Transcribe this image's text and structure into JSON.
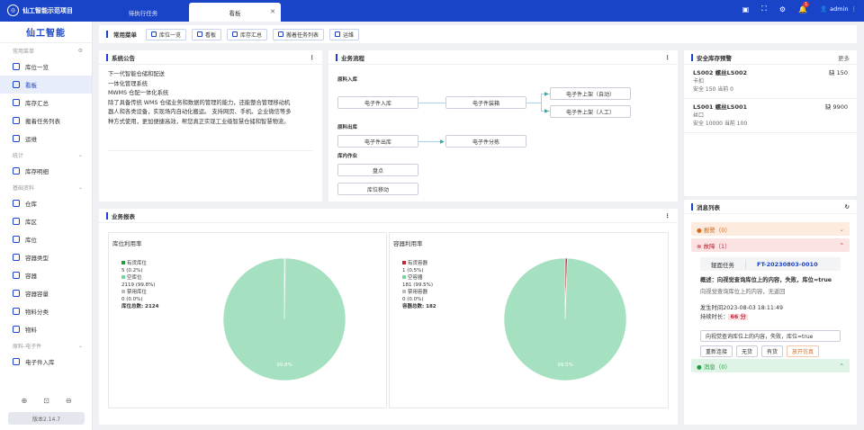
{
  "app": {
    "title": "仙工智能示范项目",
    "logo_text": "仙工智能",
    "user": "admin",
    "notify_count": "1"
  },
  "tabs": [
    {
      "label": "待执行任务"
    },
    {
      "label": "看板"
    }
  ],
  "sidebar": {
    "groups": {
      "common": "常用菜单",
      "stats": "统计",
      "basic": "基础资料",
      "raw": "原料-电子件"
    },
    "items": [
      "库位一览",
      "看板",
      "库存汇总",
      "搬着任务列表",
      "运维",
      "库存明细",
      "仓库",
      "库区",
      "库位",
      "容器类型",
      "容器",
      "容器容量",
      "物料分类",
      "物料",
      "电子件入库"
    ],
    "version": "版本2.14.7"
  },
  "quick": {
    "title": "常用菜单",
    "buttons": [
      "库位一览",
      "看板",
      "库存汇总",
      "搬着任务列表",
      "运维"
    ]
  },
  "announcement": {
    "title": "系统公告",
    "lines": [
      "下一代智能仓储和配送",
      "一体化管理系统",
      "MWMS 仓配一体化系统",
      "除了具备传统 WMS 仓储业务和数据的管理的能力，还能整合管理移动机",
      "器人和各类设备，实现场内自动化搬运。 支持网页、手机、企业微信等多",
      "种方式使用，更加便捷高效，帮您真正实现工业级智慧仓储和智慧物流。"
    ]
  },
  "flow": {
    "title": "业务流程",
    "sections": {
      "in": "原料入库",
      "out": "原料出库",
      "warehouse": "库内作业"
    },
    "nodes": {
      "in1": "电子件入库",
      "in2": "电子件装箱",
      "in3": "电子件上架（自动）",
      "in4": "电子件上架（人工）",
      "out1": "电子件出库",
      "out2": "电子件分拣",
      "w1": "盘点",
      "w2": "库位移动"
    }
  },
  "safety": {
    "title": "安全库存预警",
    "more": "更多",
    "items": [
      {
        "code": "LS002 螺丝LS002",
        "short": "缺 150",
        "loc": "卡扣",
        "stock": "安全 150  当前 0"
      },
      {
        "code": "LS001 螺丝LS001",
        "short": "缺 9900",
        "loc": "丝口",
        "stock": "安全 10000  当前 100"
      }
    ]
  },
  "report": {
    "title": "业务报表",
    "charts": [
      {
        "title": "库位利用率",
        "legend": [
          {
            "label": "有货库位",
            "value": "5 (0.2%)",
            "color": "#1e9e3e"
          },
          {
            "label": "空库位",
            "value": "2119 (99.8%)",
            "color": "#7ad6a0"
          },
          {
            "label": "禁用库位",
            "value": "0 (0.0%)",
            "color": "#bbbbbb"
          }
        ],
        "total": "库位总数: 2124",
        "center_label": "99.8%"
      },
      {
        "title": "容器利用率",
        "legend": [
          {
            "label": "有货容器",
            "value": "1 (0.5%)",
            "color": "#c0283a"
          },
          {
            "label": "空容器",
            "value": "181 (99.5%)",
            "color": "#7ad6a0"
          },
          {
            "label": "禁用容器",
            "value": "0 (0.0%)",
            "color": "#bbbbbb"
          }
        ],
        "total": "容器总数: 182",
        "center_label": "99.5%"
      }
    ]
  },
  "chart_data": [
    {
      "type": "pie",
      "title": "库位利用率",
      "categories": [
        "有货库位",
        "空库位",
        "禁用库位"
      ],
      "values": [
        5,
        2119,
        0
      ],
      "colors": [
        "#1e9e3e",
        "#a5e0c0",
        "#bbbbbb"
      ]
    },
    {
      "type": "pie",
      "title": "容器利用率",
      "categories": [
        "有货容器",
        "空容器",
        "禁用容器"
      ],
      "values": [
        1,
        181,
        0
      ],
      "colors": [
        "#c0283a",
        "#a5e0c0",
        "#bbbbbb"
      ]
    }
  ],
  "messages": {
    "title": "消息列表",
    "warn": "报警（0）",
    "error": "故障（1）",
    "info": "消息（0）",
    "detail_tab1": "辊面任务",
    "detail_tab2": "FT-20230803-0010",
    "summary": "概述：向视觉查询库位上的内容，失败，库位=true",
    "desc": "向视觉查询库位上的内容，无返回",
    "time": "发生时间2023-08-03 18:11:49",
    "duration_label": "持续时长：",
    "duration": "66 分",
    "action_text": "向视觉查询库位上的内容，失败，库位=true",
    "buttons": [
      "重新连接",
      "无货",
      "有货",
      "放开仿真"
    ]
  }
}
